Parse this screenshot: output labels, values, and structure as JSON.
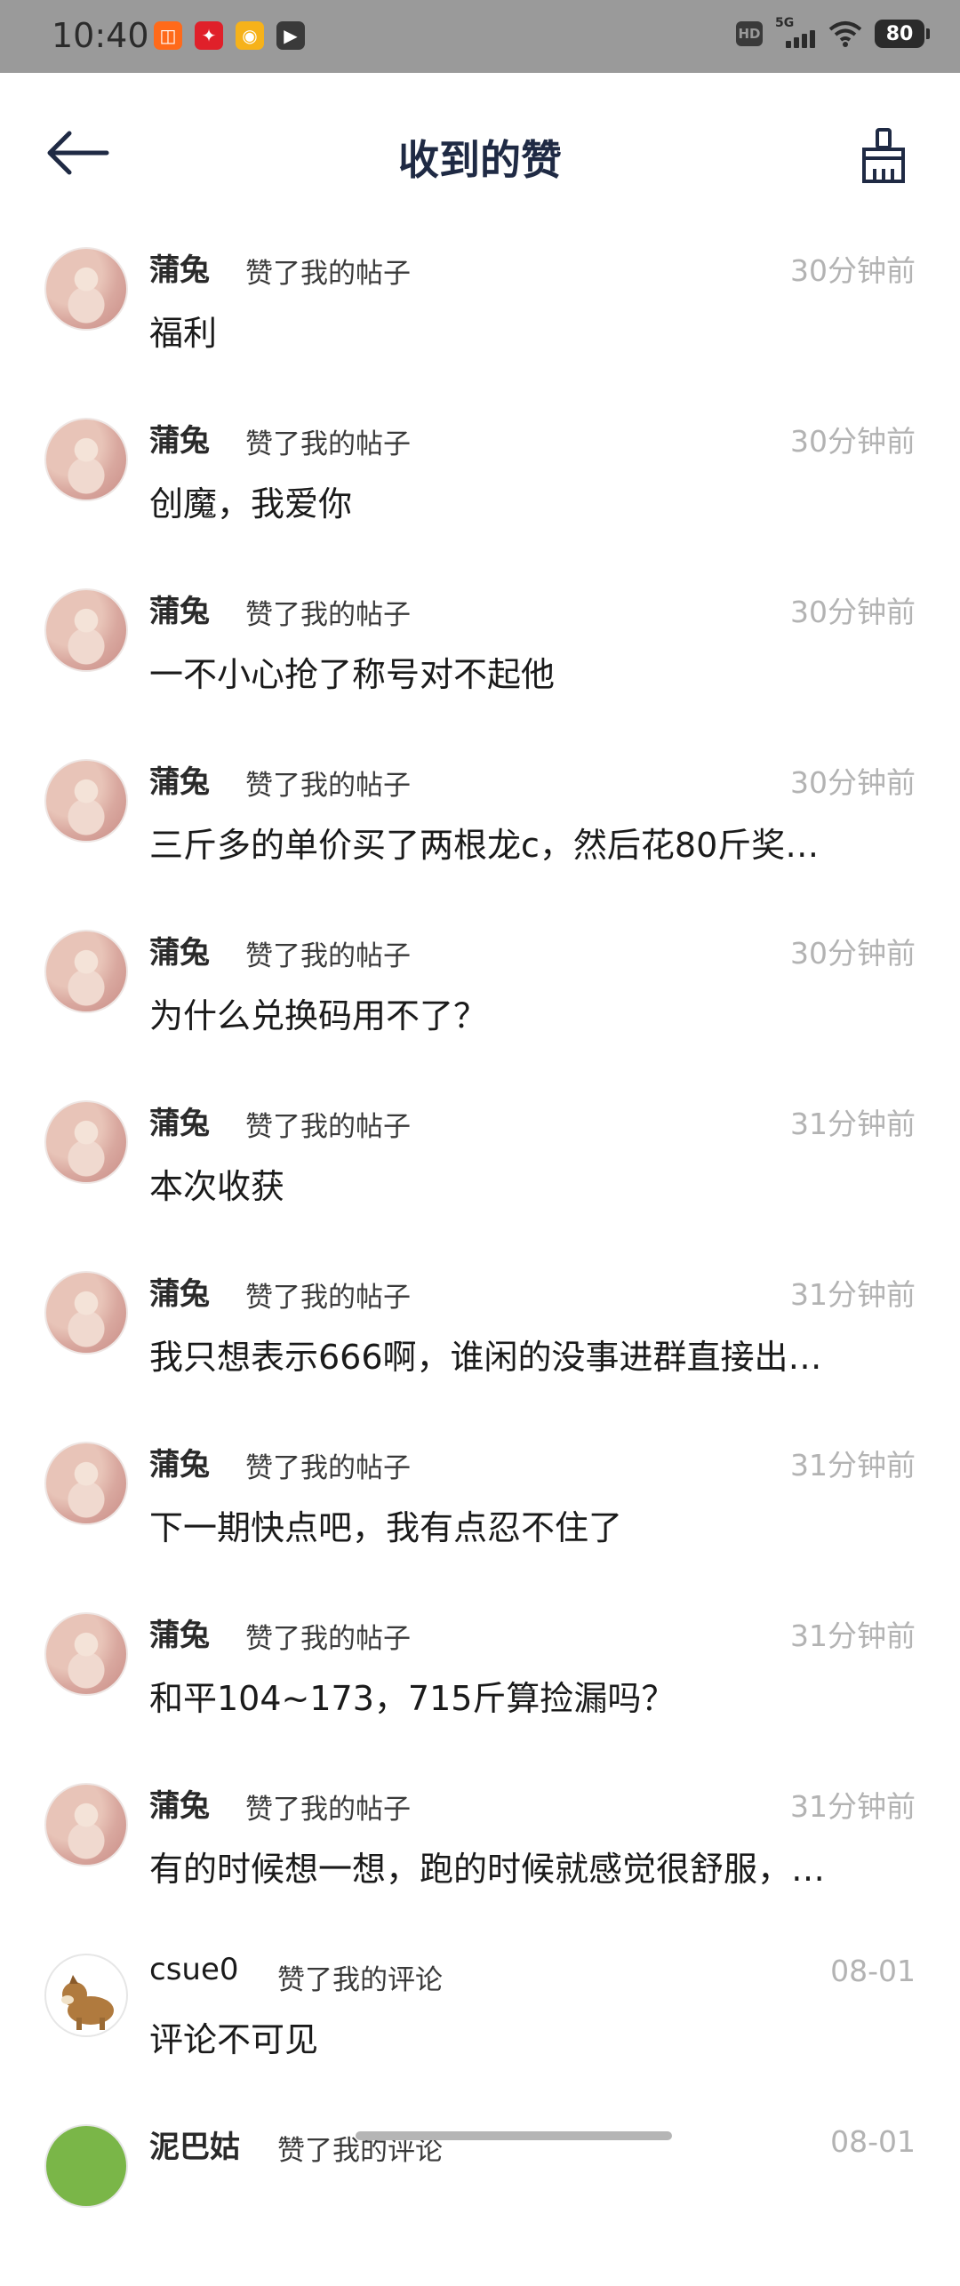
{
  "status_bar": {
    "time": "10:40",
    "app_icons": [
      "app-icon-1",
      "app-icon-2",
      "weibo-icon",
      "play-icon"
    ],
    "hd": "HD",
    "network": "5G",
    "battery": "80"
  },
  "header": {
    "title": "收到的赞",
    "back_icon": "arrow-left-icon",
    "clean_icon": "broom-icon"
  },
  "items": [
    {
      "name": "蒲兔",
      "action": "赞了我的帖子",
      "time": "30分钟前",
      "content": "福利",
      "avatar": "rabbit"
    },
    {
      "name": "蒲兔",
      "action": "赞了我的帖子",
      "time": "30分钟前",
      "content": "创魔，我爱你",
      "avatar": "rabbit"
    },
    {
      "name": "蒲兔",
      "action": "赞了我的帖子",
      "time": "30分钟前",
      "content": "一不小心抢了称号对不起他",
      "avatar": "rabbit"
    },
    {
      "name": "蒲兔",
      "action": "赞了我的帖子",
      "time": "30分钟前",
      "content": "三斤多的单价买了两根龙c，然后花80斤奖…",
      "avatar": "rabbit"
    },
    {
      "name": "蒲兔",
      "action": "赞了我的帖子",
      "time": "30分钟前",
      "content": "为什么兑换码用不了？",
      "avatar": "rabbit"
    },
    {
      "name": "蒲兔",
      "action": "赞了我的帖子",
      "time": "31分钟前",
      "content": "本次收获",
      "avatar": "rabbit"
    },
    {
      "name": "蒲兔",
      "action": "赞了我的帖子",
      "time": "31分钟前",
      "content": "我只想表示666啊，谁闲的没事进群直接出…",
      "avatar": "rabbit"
    },
    {
      "name": "蒲兔",
      "action": "赞了我的帖子",
      "time": "31分钟前",
      "content": "下一期快点吧，我有点忍不住了",
      "avatar": "rabbit"
    },
    {
      "name": "蒲兔",
      "action": "赞了我的帖子",
      "time": "31分钟前",
      "content": "和平104~173，715斤算捡漏吗？",
      "avatar": "rabbit"
    },
    {
      "name": "蒲兔",
      "action": "赞了我的帖子",
      "time": "31分钟前",
      "content": "有的时候想一想，跑的时候就感觉很舒服，…",
      "avatar": "rabbit"
    },
    {
      "name": "csue0",
      "action": "赞了我的评论",
      "time": "08-01",
      "content": "评论不可见",
      "avatar": "dog"
    },
    {
      "name": "泥巴姑",
      "action": "赞了我的评论",
      "time": "08-01",
      "content": "",
      "avatar": "green"
    }
  ]
}
